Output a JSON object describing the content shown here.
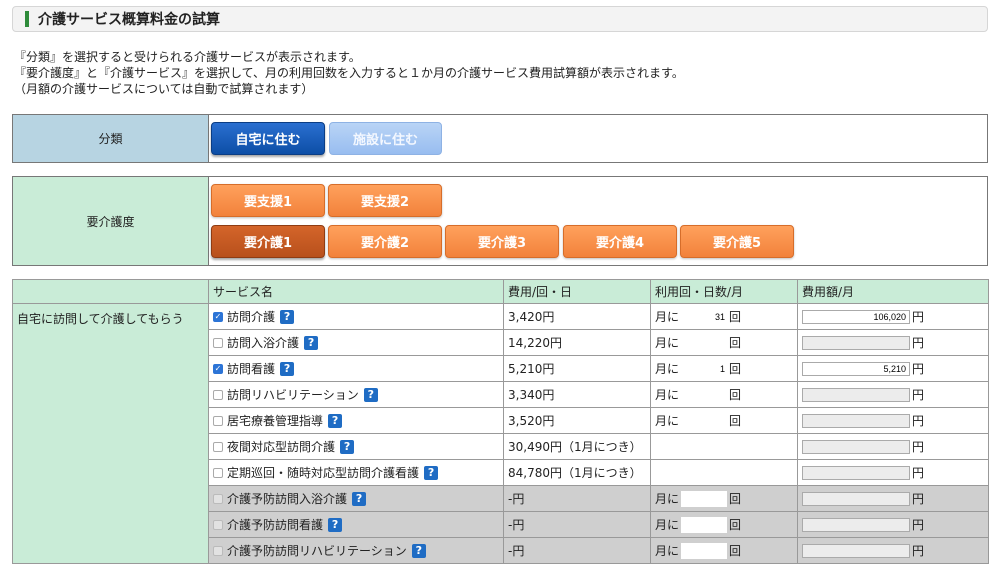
{
  "page": {
    "title": "介護サービス概算料金の試算"
  },
  "description": [
    "『分類』を選択すると受けられる介護サービスが表示されます。",
    "『要介護度』と『介護サービス』を選択して、月の利用回数を入力すると１か月の介護サービス費用試算額が表示されます。",
    "（月額の介護サービスについては自動で試算されます）"
  ],
  "category": {
    "label": "分類",
    "options": [
      "自宅に住む",
      "施設に住む"
    ],
    "selected": "自宅に住む"
  },
  "care_level": {
    "label": "要介護度",
    "support_options": [
      "要支援1",
      "要支援2"
    ],
    "care_options": [
      "要介護1",
      "要介護2",
      "要介護3",
      "要介護4",
      "要介護5"
    ],
    "selected": "要介護1"
  },
  "table": {
    "headers": [
      "サービス名",
      "費用/回・日",
      "利用回・日数/月",
      "費用額/月"
    ],
    "group_label": "自宅に訪問して介護してもらう",
    "rows": [
      {
        "name": "訪問介護",
        "checked": true,
        "disabled": false,
        "cost": "3,420円",
        "use_prefix": "月に",
        "use_value": "31",
        "use_suffix": "回",
        "fee_value": "106,020",
        "fee_unit": "円"
      },
      {
        "name": "訪問入浴介護",
        "checked": false,
        "disabled": false,
        "cost": "14,220円",
        "use_prefix": "月に",
        "use_value": "",
        "use_suffix": "回",
        "fee_value": "",
        "fee_unit": "円"
      },
      {
        "name": "訪問看護",
        "checked": true,
        "disabled": false,
        "cost": "5,210円",
        "use_prefix": "月に",
        "use_value": "1",
        "use_suffix": "回",
        "fee_value": "5,210",
        "fee_unit": "円"
      },
      {
        "name": "訪問リハビリテーション",
        "checked": false,
        "disabled": false,
        "cost": "3,340円",
        "use_prefix": "月に",
        "use_value": "",
        "use_suffix": "回",
        "fee_value": "",
        "fee_unit": "円"
      },
      {
        "name": "居宅療養管理指導",
        "checked": false,
        "disabled": false,
        "cost": "3,520円",
        "use_prefix": "月に",
        "use_value": "",
        "use_suffix": "回",
        "fee_value": "",
        "fee_unit": "円"
      },
      {
        "name": "夜間対応型訪問介護",
        "checked": false,
        "disabled": false,
        "cost": "30,490円（1月につき）",
        "use_prefix": "",
        "use_value": null,
        "use_suffix": "",
        "fee_value": "",
        "fee_unit": "円"
      },
      {
        "name": "定期巡回・随時対応型訪問介護看護",
        "checked": false,
        "disabled": false,
        "cost": "84,780円（1月につき）",
        "use_prefix": "",
        "use_value": null,
        "use_suffix": "",
        "fee_value": "",
        "fee_unit": "円"
      },
      {
        "name": "介護予防訪問入浴介護",
        "checked": false,
        "disabled": true,
        "cost": "-円",
        "use_prefix": "月に",
        "use_value": "",
        "use_suffix": "回",
        "fee_value": "",
        "fee_unit": "円"
      },
      {
        "name": "介護予防訪問看護",
        "checked": false,
        "disabled": true,
        "cost": "-円",
        "use_prefix": "月に",
        "use_value": "",
        "use_suffix": "回",
        "fee_value": "",
        "fee_unit": "円"
      },
      {
        "name": "介護予防訪問リハビリテーション",
        "checked": false,
        "disabled": true,
        "cost": "-円",
        "use_prefix": "月に",
        "use_value": "",
        "use_suffix": "回",
        "fee_value": "",
        "fee_unit": "円"
      }
    ]
  },
  "icons": {
    "help": "question-icon",
    "check": "checkbox-icon"
  },
  "colors": {
    "primary_blue": "#0d4ea6",
    "orange": "#f2823b",
    "selected_orange": "#b8501c",
    "green_header": "#c9ecd7",
    "blue_label": "#b7d4e2"
  }
}
